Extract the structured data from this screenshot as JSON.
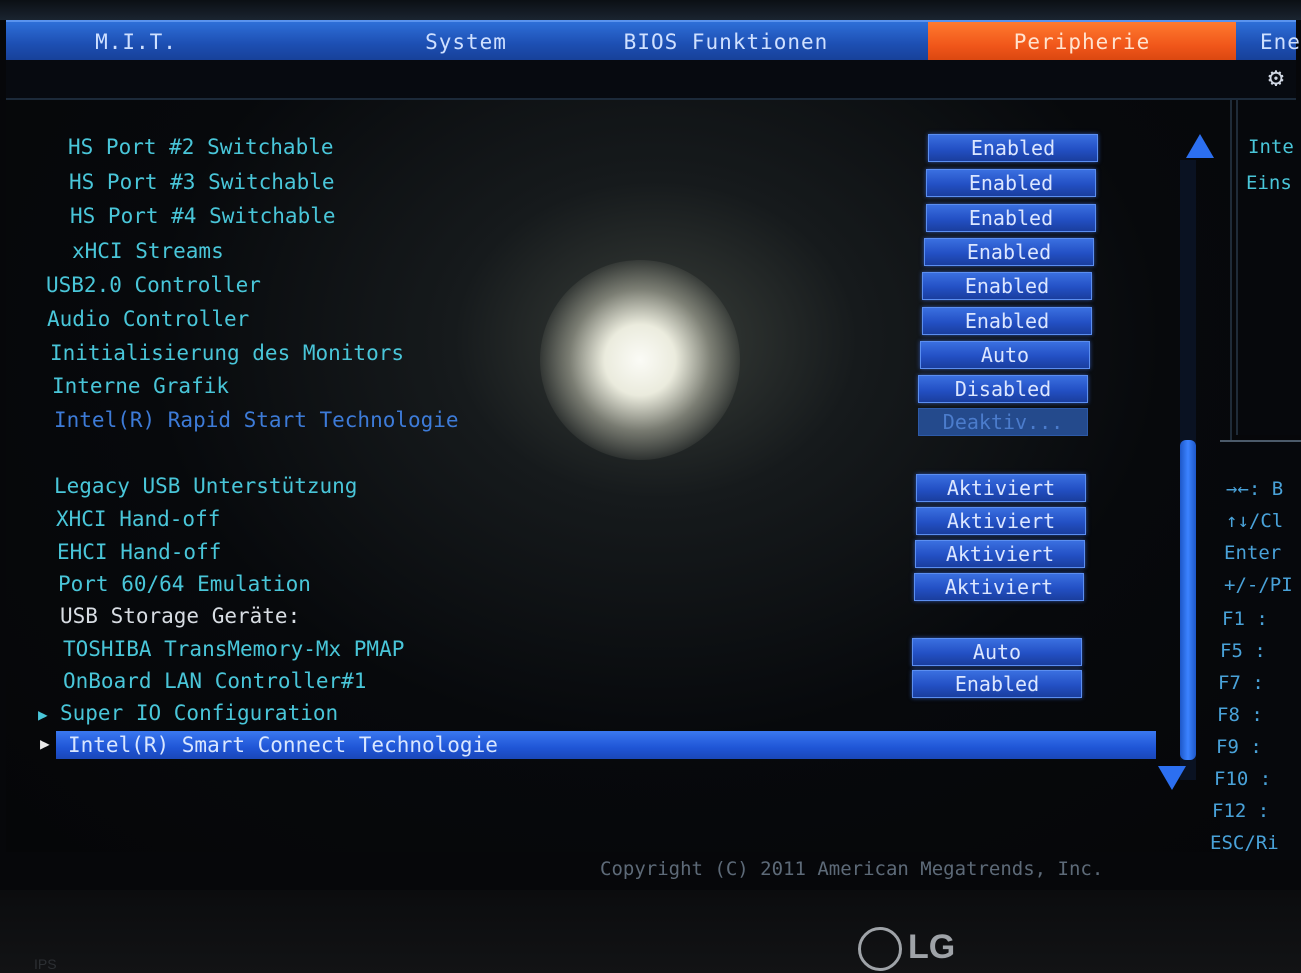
{
  "tabs": [
    {
      "label": "M.I.T."
    },
    {
      "label": "System"
    },
    {
      "label": "BIOS Funktionen"
    },
    {
      "label": "Peripherie",
      "active": true
    },
    {
      "label": "Ene"
    }
  ],
  "settings": [
    {
      "label": "HS Port #2 Switchable",
      "value": "Enabled"
    },
    {
      "label": "HS Port #3 Switchable",
      "value": "Enabled"
    },
    {
      "label": "HS Port #4 Switchable",
      "value": "Enabled"
    },
    {
      "label": "xHCI Streams",
      "value": "Enabled"
    },
    {
      "label": "USB2.0 Controller",
      "value": "Enabled"
    },
    {
      "label": "Audio Controller",
      "value": "Enabled"
    },
    {
      "label": "Initialisierung des Monitors",
      "value": "Auto"
    },
    {
      "label": "Interne Grafik",
      "value": "Disabled"
    },
    {
      "label": "Intel(R) Rapid Start Technologie",
      "value": "Deaktiv..."
    },
    {
      "label": "Legacy USB Unterstützung",
      "value": "Aktiviert"
    },
    {
      "label": "XHCI Hand-off",
      "value": "Aktiviert"
    },
    {
      "label": "EHCI Hand-off",
      "value": "Aktiviert"
    },
    {
      "label": "Port 60/64 Emulation",
      "value": "Aktiviert"
    },
    {
      "label": "USB Storage Geräte:"
    },
    {
      "label": "TOSHIBA TransMemory-Mx PMAP",
      "value": "Auto"
    },
    {
      "label": "OnBoard LAN Controller#1",
      "value": "Enabled"
    },
    {
      "label": "Super IO Configuration"
    },
    {
      "label": "Intel(R) Smart Connect Technologie"
    }
  ],
  "help": {
    "line1": "Inte",
    "line2": "Eins"
  },
  "keys": [
    "→←: B",
    "↑↓/Cl",
    "Enter",
    "+/-/PI",
    "F1  :",
    "F5  :",
    "F7  :",
    "F8  :",
    "F9  :",
    "F10 :",
    "F12 :",
    "ESC/Ri"
  ],
  "footer": {
    "copyright": "Copyright (C) 2011 American Megatrends, Inc."
  },
  "monitor": {
    "brand": "LG",
    "badge": "IPS"
  },
  "icons": {
    "gear": "gear-icon",
    "submenu_arrow": "triangle-right-icon",
    "scroll_up": "triangle-up-icon",
    "scroll_down": "triangle-down-icon"
  },
  "colors": {
    "tab_bar": "#1d4fb3",
    "active_tab": "#f0561a",
    "label_text": "#49c6d9",
    "value_box": "#2350c4",
    "selection": "#1f55d6"
  }
}
